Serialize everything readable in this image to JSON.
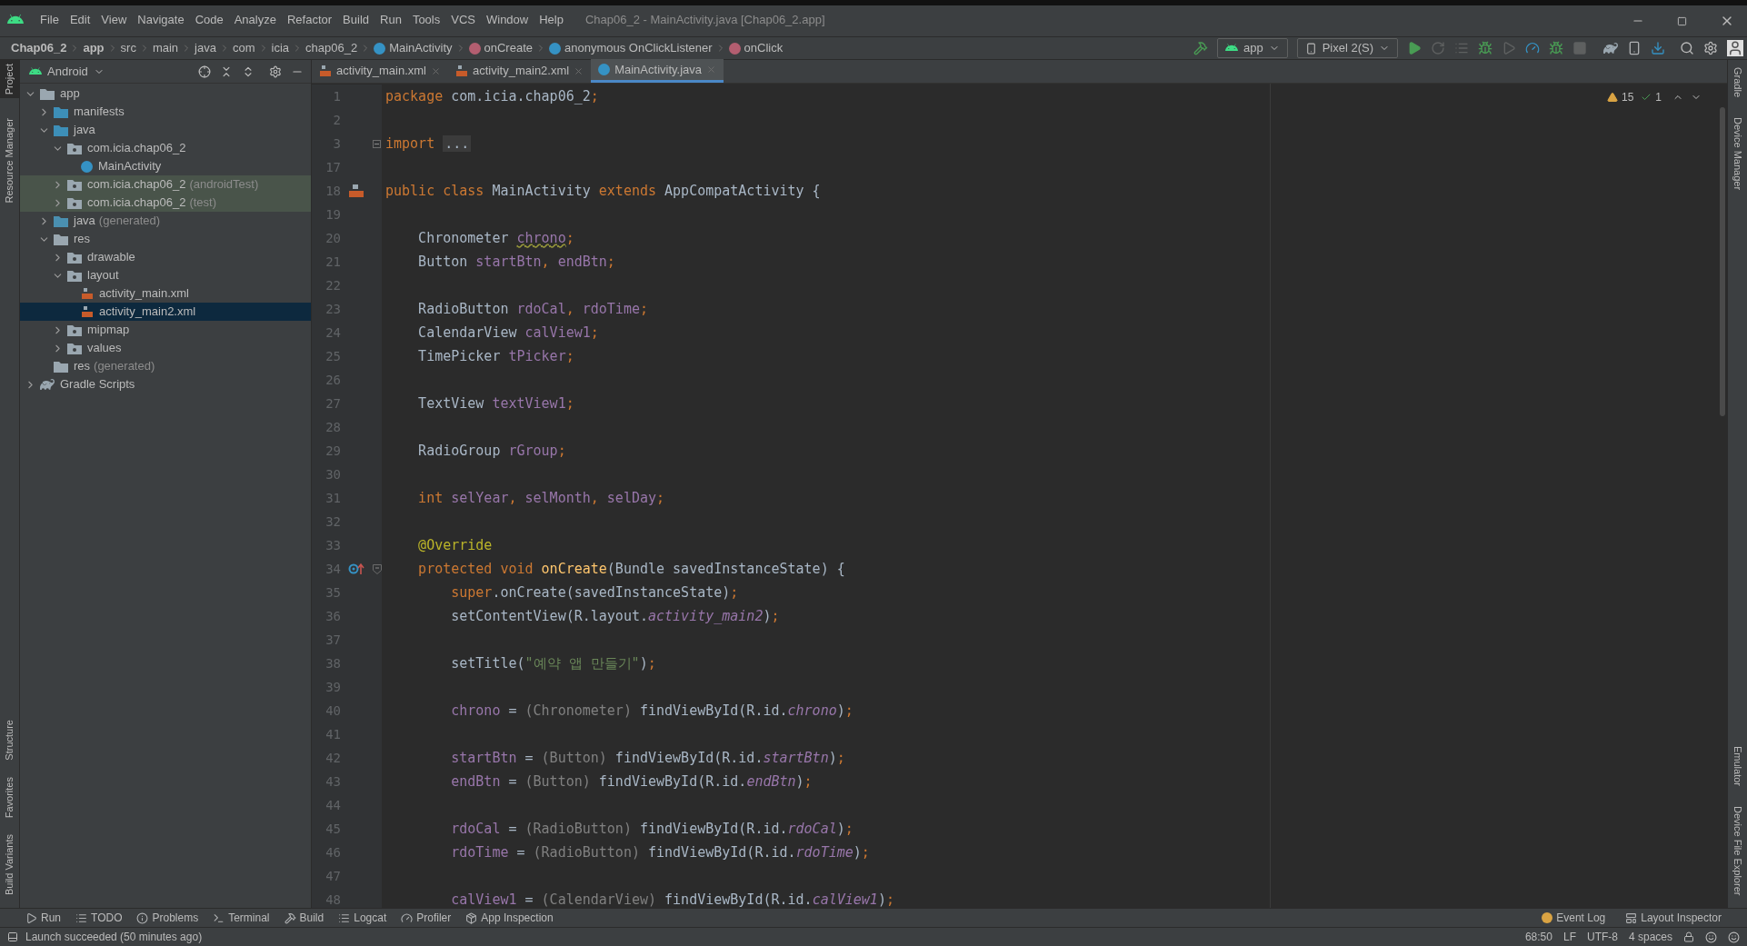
{
  "window": {
    "title": "Chap06_2 - MainActivity.java [Chap06_2.app]"
  },
  "menu": [
    "File",
    "Edit",
    "View",
    "Navigate",
    "Code",
    "Analyze",
    "Refactor",
    "Build",
    "Run",
    "Tools",
    "VCS",
    "Window",
    "Help"
  ],
  "breadcrumb": [
    {
      "label": "Chap06_2",
      "bold": true
    },
    {
      "label": "app",
      "bold": true
    },
    {
      "label": "src",
      "bold": false
    },
    {
      "label": "main",
      "bold": false
    },
    {
      "label": "java",
      "bold": false
    },
    {
      "label": "com",
      "bold": false
    },
    {
      "label": "icia",
      "bold": false
    },
    {
      "label": "chap06_2",
      "bold": false
    },
    {
      "label": "MainActivity",
      "bold": false,
      "kind": "class"
    },
    {
      "label": "onCreate",
      "bold": false,
      "kind": "method"
    },
    {
      "label": "anonymous OnClickListener",
      "bold": false,
      "kind": "lambda"
    },
    {
      "label": "onClick",
      "bold": false,
      "kind": "method"
    }
  ],
  "run_config": {
    "module": "app",
    "device": "Pixel 2(S)"
  },
  "left_stripe_top": [
    {
      "label": "Project",
      "selected": true
    },
    {
      "label": "Resource Manager",
      "selected": false
    }
  ],
  "left_stripe_bottom": [
    {
      "label": "Structure",
      "selected": false
    },
    {
      "label": "Favorites",
      "selected": false
    },
    {
      "label": "Build Variants",
      "selected": false
    }
  ],
  "right_stripe_top": [
    {
      "label": "Gradle"
    },
    {
      "label": "Device Manager"
    }
  ],
  "right_stripe_bottom": [
    {
      "label": "Emulator"
    },
    {
      "label": "Device File Explorer"
    }
  ],
  "project": {
    "view": "Android",
    "tree": [
      {
        "label": "app",
        "kind": "module",
        "expanded": true,
        "selected": false,
        "children": [
          {
            "label": "manifests",
            "kind": "source",
            "expanded": false,
            "selected": false
          },
          {
            "label": "java",
            "kind": "source",
            "expanded": true,
            "selected": false,
            "children": [
              {
                "label": "com.icia.chap06_2",
                "kind": "package",
                "expanded": true,
                "selected": false,
                "children": [
                  {
                    "label": "MainActivity",
                    "kind": "class",
                    "selected": false
                  }
                ]
              },
              {
                "label": "com.icia.chap06_2",
                "suffix": "(androidTest)",
                "kind": "test-package",
                "expanded": false,
                "selected": false
              },
              {
                "label": "com.icia.chap06_2",
                "suffix": "(test)",
                "kind": "test-package",
                "expanded": false,
                "selected": false
              }
            ]
          },
          {
            "label": "java",
            "suffix": "(generated)",
            "kind": "generated",
            "expanded": false,
            "selected": false
          },
          {
            "label": "res",
            "kind": "res",
            "expanded": true,
            "selected": false,
            "children": [
              {
                "label": "drawable",
                "kind": "package",
                "expanded": false,
                "selected": false
              },
              {
                "label": "layout",
                "kind": "package",
                "expanded": true,
                "selected": false,
                "children": [
                  {
                    "label": "activity_main.xml",
                    "kind": "xml",
                    "selected": false
                  },
                  {
                    "label": "activity_main2.xml",
                    "kind": "xml",
                    "selected": true
                  }
                ]
              },
              {
                "label": "mipmap",
                "kind": "package",
                "expanded": false,
                "selected": false
              },
              {
                "label": "values",
                "kind": "package",
                "expanded": false,
                "selected": false
              }
            ]
          },
          {
            "label": "res",
            "suffix": "(generated)",
            "kind": "res",
            "selected": false
          }
        ]
      },
      {
        "label": "Gradle Scripts",
        "kind": "gradle",
        "expanded": false,
        "selected": false
      }
    ]
  },
  "tabs": [
    {
      "label": "activity_main.xml",
      "kind": "xml",
      "selected": false
    },
    {
      "label": "activity_main2.xml",
      "kind": "xml",
      "selected": false
    },
    {
      "label": "MainActivity.java",
      "kind": "class",
      "selected": true
    }
  ],
  "inspections": {
    "warnings": "15",
    "passed": "1"
  },
  "code": [
    {
      "number": "1",
      "tokens": [
        {
          "kind": "keyword",
          "text": "package"
        },
        {
          "kind": "plain",
          "text": " com.icia.chap06_2"
        },
        {
          "kind": "keyword",
          "text": ";"
        }
      ]
    },
    {
      "number": "2"
    },
    {
      "number": "3",
      "fold": {
        "kind": "collapsed"
      },
      "tokens": [
        {
          "kind": "keyword",
          "text": "import "
        },
        {
          "kind": "folded",
          "text": "..."
        }
      ]
    },
    {
      "number": "17"
    },
    {
      "number": "18",
      "gutter": {
        "kind": "layout"
      },
      "tokens": [
        {
          "kind": "keyword",
          "text": "public class "
        },
        {
          "kind": "plain",
          "text": "MainActivity "
        },
        {
          "kind": "keyword",
          "text": "extends "
        },
        {
          "kind": "plain",
          "text": "AppCompatActivity {"
        }
      ]
    },
    {
      "number": "19"
    },
    {
      "number": "20",
      "tokens": [
        {
          "kind": "plain",
          "text": "    Chronometer "
        },
        {
          "kind": "field-warning",
          "text": "chrono"
        },
        {
          "kind": "keyword",
          "text": ";"
        }
      ]
    },
    {
      "number": "21",
      "tokens": [
        {
          "kind": "plain",
          "text": "    Button "
        },
        {
          "kind": "field",
          "text": "startBtn"
        },
        {
          "kind": "keyword",
          "text": ", "
        },
        {
          "kind": "field",
          "text": "endBtn"
        },
        {
          "kind": "keyword",
          "text": ";"
        }
      ]
    },
    {
      "number": "22"
    },
    {
      "number": "23",
      "tokens": [
        {
          "kind": "plain",
          "text": "    RadioButton "
        },
        {
          "kind": "field",
          "text": "rdoCal"
        },
        {
          "kind": "keyword",
          "text": ", "
        },
        {
          "kind": "field",
          "text": "rdoTime"
        },
        {
          "kind": "keyword",
          "text": ";"
        }
      ]
    },
    {
      "number": "24",
      "tokens": [
        {
          "kind": "plain",
          "text": "    CalendarView "
        },
        {
          "kind": "field",
          "text": "calView1"
        },
        {
          "kind": "keyword",
          "text": ";"
        }
      ]
    },
    {
      "number": "25",
      "tokens": [
        {
          "kind": "plain",
          "text": "    TimePicker "
        },
        {
          "kind": "field",
          "text": "tPicker"
        },
        {
          "kind": "keyword",
          "text": ";"
        }
      ]
    },
    {
      "number": "26"
    },
    {
      "number": "27",
      "tokens": [
        {
          "kind": "plain",
          "text": "    TextView "
        },
        {
          "kind": "field",
          "text": "textView1"
        },
        {
          "kind": "keyword",
          "text": ";"
        }
      ]
    },
    {
      "number": "28"
    },
    {
      "number": "29",
      "tokens": [
        {
          "kind": "plain",
          "text": "    RadioGroup "
        },
        {
          "kind": "field",
          "text": "rGroup"
        },
        {
          "kind": "keyword",
          "text": ";"
        }
      ]
    },
    {
      "number": "30"
    },
    {
      "number": "31",
      "tokens": [
        {
          "kind": "keyword",
          "text": "    int "
        },
        {
          "kind": "field",
          "text": "selYear"
        },
        {
          "kind": "keyword",
          "text": ", "
        },
        {
          "kind": "field",
          "text": "selMonth"
        },
        {
          "kind": "keyword",
          "text": ", "
        },
        {
          "kind": "field",
          "text": "selDay"
        },
        {
          "kind": "keyword",
          "text": ";"
        }
      ]
    },
    {
      "number": "32"
    },
    {
      "number": "33",
      "tokens": [
        {
          "kind": "annotation",
          "text": "    @Override"
        }
      ]
    },
    {
      "number": "34",
      "gutter": {
        "kind": "override"
      },
      "fold": {
        "kind": "expanded"
      },
      "tokens": [
        {
          "kind": "keyword",
          "text": "    protected void "
        },
        {
          "kind": "method",
          "text": "onCreate"
        },
        {
          "kind": "plain",
          "text": "(Bundle savedInstanceState) {"
        }
      ]
    },
    {
      "number": "35",
      "tokens": [
        {
          "kind": "keyword",
          "text": "        super"
        },
        {
          "kind": "plain",
          "text": ".onCreate(savedInstanceState)"
        },
        {
          "kind": "keyword",
          "text": ";"
        }
      ]
    },
    {
      "number": "36",
      "tokens": [
        {
          "kind": "plain",
          "text": "        setContentView(R.layout."
        },
        {
          "kind": "static",
          "text": "activity_main2"
        },
        {
          "kind": "plain",
          "text": ")"
        },
        {
          "kind": "keyword",
          "text": ";"
        }
      ]
    },
    {
      "number": "37"
    },
    {
      "number": "38",
      "tokens": [
        {
          "kind": "plain",
          "text": "        setTitle("
        },
        {
          "kind": "string",
          "text": "\"예약 앱 만들기\""
        },
        {
          "kind": "plain",
          "text": ")"
        },
        {
          "kind": "keyword",
          "text": ";"
        }
      ]
    },
    {
      "number": "39"
    },
    {
      "number": "40",
      "tokens": [
        {
          "kind": "field",
          "text": "        chrono"
        },
        {
          "kind": "plain",
          "text": " = "
        },
        {
          "kind": "cast",
          "text": "(Chronometer)"
        },
        {
          "kind": "plain",
          "text": " findViewById(R.id."
        },
        {
          "kind": "static",
          "text": "chrono"
        },
        {
          "kind": "plain",
          "text": ")"
        },
        {
          "kind": "keyword",
          "text": ";"
        }
      ]
    },
    {
      "number": "41"
    },
    {
      "number": "42",
      "tokens": [
        {
          "kind": "field",
          "text": "        startBtn"
        },
        {
          "kind": "plain",
          "text": " = "
        },
        {
          "kind": "cast",
          "text": "(Button)"
        },
        {
          "kind": "plain",
          "text": " findViewById(R.id."
        },
        {
          "kind": "static",
          "text": "startBtn"
        },
        {
          "kind": "plain",
          "text": ")"
        },
        {
          "kind": "keyword",
          "text": ";"
        }
      ]
    },
    {
      "number": "43",
      "tokens": [
        {
          "kind": "field",
          "text": "        endBtn"
        },
        {
          "kind": "plain",
          "text": " = "
        },
        {
          "kind": "cast",
          "text": "(Button)"
        },
        {
          "kind": "plain",
          "text": " findViewById(R.id."
        },
        {
          "kind": "static",
          "text": "endBtn"
        },
        {
          "kind": "plain",
          "text": ")"
        },
        {
          "kind": "keyword",
          "text": ";"
        }
      ]
    },
    {
      "number": "44"
    },
    {
      "number": "45",
      "tokens": [
        {
          "kind": "field",
          "text": "        rdoCal"
        },
        {
          "kind": "plain",
          "text": " = "
        },
        {
          "kind": "cast",
          "text": "(RadioButton)"
        },
        {
          "kind": "plain",
          "text": " findViewById(R.id."
        },
        {
          "kind": "static",
          "text": "rdoCal"
        },
        {
          "kind": "plain",
          "text": ")"
        },
        {
          "kind": "keyword",
          "text": ";"
        }
      ]
    },
    {
      "number": "46",
      "tokens": [
        {
          "kind": "field",
          "text": "        rdoTime"
        },
        {
          "kind": "plain",
          "text": " = "
        },
        {
          "kind": "cast",
          "text": "(RadioButton)"
        },
        {
          "kind": "plain",
          "text": " findViewById(R.id."
        },
        {
          "kind": "static",
          "text": "rdoTime"
        },
        {
          "kind": "plain",
          "text": ")"
        },
        {
          "kind": "keyword",
          "text": ";"
        }
      ]
    },
    {
      "number": "47"
    },
    {
      "number": "48",
      "tokens": [
        {
          "kind": "field",
          "text": "        calView1"
        },
        {
          "kind": "plain",
          "text": " = "
        },
        {
          "kind": "cast",
          "text": "(CalendarView)"
        },
        {
          "kind": "plain",
          "text": " findViewById(R.id."
        },
        {
          "kind": "static",
          "text": "calView1"
        },
        {
          "kind": "plain",
          "text": ")"
        },
        {
          "kind": "keyword",
          "text": ";"
        }
      ]
    }
  ],
  "tool_windows": [
    {
      "label": "Run",
      "kind": "run"
    },
    {
      "label": "TODO",
      "kind": "list"
    },
    {
      "label": "Problems",
      "kind": "problems"
    },
    {
      "label": "Terminal",
      "kind": "terminal"
    },
    {
      "label": "Build",
      "kind": "hammer"
    },
    {
      "label": "Logcat",
      "kind": "list"
    },
    {
      "label": "Profiler",
      "kind": "gauge"
    },
    {
      "label": "App Inspection",
      "kind": "inspect"
    }
  ],
  "tool_windows_right": [
    {
      "label": "Event Log",
      "kind": "event"
    },
    {
      "label": "Layout Inspector",
      "kind": "layout"
    }
  ],
  "status_bar": {
    "message": "Launch succeeded (50 minutes ago)",
    "position": "68:50",
    "line_separator": "LF",
    "encoding": "UTF-8",
    "indent": "4 spaces"
  }
}
